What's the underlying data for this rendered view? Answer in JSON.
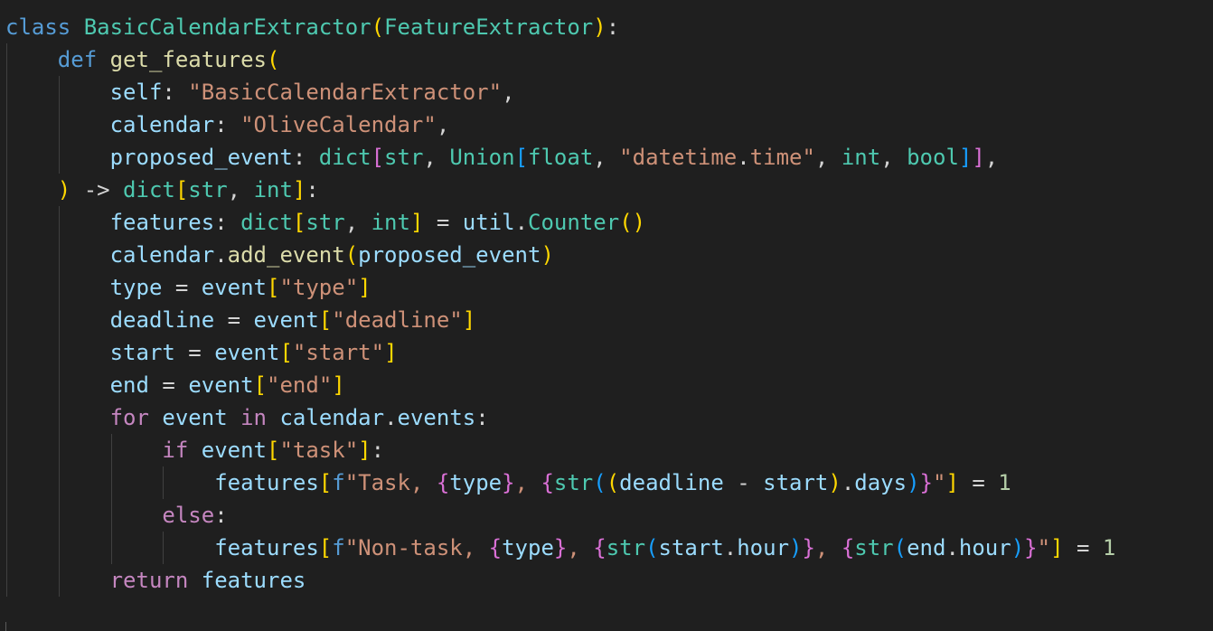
{
  "editor": {
    "language": "python",
    "theme_colors": {
      "background": "#1f1f1f",
      "keyword": "#569cd6",
      "control": "#c586c0",
      "class_name": "#4ec9b0",
      "function": "#dcdcaa",
      "variable": "#9cdcfe",
      "string": "#ce9178",
      "number": "#b5cea8",
      "punct": "#d4d4d4",
      "bracket1": "#ffd700",
      "bracket2": "#da70d6",
      "bracket3": "#179fff"
    },
    "lines": [
      [
        [
          "class",
          "kw"
        ],
        [
          " ",
          "p"
        ],
        [
          "BasicCalendarExtractor",
          "cls"
        ],
        [
          "(",
          "b1"
        ],
        [
          "FeatureExtractor",
          "cls"
        ],
        [
          ")",
          "b1"
        ],
        [
          ":",
          "p"
        ]
      ],
      [
        [
          "    ",
          "p"
        ],
        [
          "def",
          "kw"
        ],
        [
          " ",
          "p"
        ],
        [
          "get_features",
          "fn"
        ],
        [
          "(",
          "b1"
        ]
      ],
      [
        [
          "        ",
          "p"
        ],
        [
          "self",
          "var"
        ],
        [
          ": ",
          "p"
        ],
        [
          "\"BasicCalendarExtractor\"",
          "str"
        ],
        [
          ",",
          "p"
        ]
      ],
      [
        [
          "        ",
          "p"
        ],
        [
          "calendar",
          "var"
        ],
        [
          ": ",
          "p"
        ],
        [
          "\"OliveCalendar\"",
          "str"
        ],
        [
          ",",
          "p"
        ]
      ],
      [
        [
          "        ",
          "p"
        ],
        [
          "proposed_event",
          "var"
        ],
        [
          ": ",
          "p"
        ],
        [
          "dict",
          "cls"
        ],
        [
          "[",
          "b2"
        ],
        [
          "str",
          "cls"
        ],
        [
          ", ",
          "p"
        ],
        [
          "Union",
          "cls"
        ],
        [
          "[",
          "b3"
        ],
        [
          "float",
          "cls"
        ],
        [
          ", ",
          "p"
        ],
        [
          "\"datetime",
          "str"
        ],
        [
          ".",
          "p"
        ],
        [
          "time\"",
          "str"
        ],
        [
          ", ",
          "p"
        ],
        [
          "int",
          "cls"
        ],
        [
          ", ",
          "p"
        ],
        [
          "bool",
          "cls"
        ],
        [
          "]",
          "b3"
        ],
        [
          "]",
          "b2"
        ],
        [
          ",",
          "p"
        ]
      ],
      [
        [
          "    ",
          "p"
        ],
        [
          ")",
          "b1"
        ],
        [
          " -> ",
          "p"
        ],
        [
          "dict",
          "cls"
        ],
        [
          "[",
          "b1"
        ],
        [
          "str",
          "cls"
        ],
        [
          ", ",
          "p"
        ],
        [
          "int",
          "cls"
        ],
        [
          "]",
          "b1"
        ],
        [
          ":",
          "p"
        ]
      ],
      [
        [
          "        ",
          "p"
        ],
        [
          "features",
          "var"
        ],
        [
          ": ",
          "p"
        ],
        [
          "dict",
          "cls"
        ],
        [
          "[",
          "b1"
        ],
        [
          "str",
          "cls"
        ],
        [
          ", ",
          "p"
        ],
        [
          "int",
          "cls"
        ],
        [
          "]",
          "b1"
        ],
        [
          " = ",
          "p"
        ],
        [
          "util",
          "var"
        ],
        [
          ".",
          "p"
        ],
        [
          "Counter",
          "cls"
        ],
        [
          "()",
          "b1"
        ]
      ],
      [
        [
          "        ",
          "p"
        ],
        [
          "calendar",
          "var"
        ],
        [
          ".",
          "p"
        ],
        [
          "add_event",
          "fn"
        ],
        [
          "(",
          "b1"
        ],
        [
          "proposed_event",
          "var"
        ],
        [
          ")",
          "b1"
        ]
      ],
      [
        [
          "        ",
          "p"
        ],
        [
          "type",
          "var"
        ],
        [
          " = ",
          "p"
        ],
        [
          "event",
          "var"
        ],
        [
          "[",
          "b1"
        ],
        [
          "\"type\"",
          "str"
        ],
        [
          "]",
          "b1"
        ]
      ],
      [
        [
          "        ",
          "p"
        ],
        [
          "deadline",
          "var"
        ],
        [
          " = ",
          "p"
        ],
        [
          "event",
          "var"
        ],
        [
          "[",
          "b1"
        ],
        [
          "\"deadline\"",
          "str"
        ],
        [
          "]",
          "b1"
        ]
      ],
      [
        [
          "        ",
          "p"
        ],
        [
          "start",
          "var"
        ],
        [
          " = ",
          "p"
        ],
        [
          "event",
          "var"
        ],
        [
          "[",
          "b1"
        ],
        [
          "\"start\"",
          "str"
        ],
        [
          "]",
          "b1"
        ]
      ],
      [
        [
          "        ",
          "p"
        ],
        [
          "end",
          "var"
        ],
        [
          " = ",
          "p"
        ],
        [
          "event",
          "var"
        ],
        [
          "[",
          "b1"
        ],
        [
          "\"end\"",
          "str"
        ],
        [
          "]",
          "b1"
        ]
      ],
      [
        [
          "        ",
          "p"
        ],
        [
          "for",
          "ctl"
        ],
        [
          " ",
          "p"
        ],
        [
          "event",
          "var"
        ],
        [
          " ",
          "p"
        ],
        [
          "in",
          "ctl"
        ],
        [
          " ",
          "p"
        ],
        [
          "calendar",
          "var"
        ],
        [
          ".",
          "p"
        ],
        [
          "events",
          "var"
        ],
        [
          ":",
          "p"
        ]
      ],
      [
        [
          "            ",
          "p"
        ],
        [
          "if",
          "ctl"
        ],
        [
          " ",
          "p"
        ],
        [
          "event",
          "var"
        ],
        [
          "[",
          "b1"
        ],
        [
          "\"task\"",
          "str"
        ],
        [
          "]",
          "b1"
        ],
        [
          ":",
          "p"
        ]
      ],
      [
        [
          "                ",
          "p"
        ],
        [
          "features",
          "var"
        ],
        [
          "[",
          "b1"
        ],
        [
          "f",
          "kw"
        ],
        [
          "\"Task, ",
          "str"
        ],
        [
          "{",
          "b2"
        ],
        [
          "type",
          "var"
        ],
        [
          "}",
          "b2"
        ],
        [
          ", ",
          "str"
        ],
        [
          "{",
          "b2"
        ],
        [
          "str",
          "cls"
        ],
        [
          "(",
          "b3"
        ],
        [
          "(",
          "b1"
        ],
        [
          "deadline",
          "var"
        ],
        [
          " - ",
          "p"
        ],
        [
          "start",
          "var"
        ],
        [
          ")",
          "b1"
        ],
        [
          ".",
          "p"
        ],
        [
          "days",
          "var"
        ],
        [
          ")",
          "b3"
        ],
        [
          "}",
          "b2"
        ],
        [
          "\"",
          "str"
        ],
        [
          "]",
          "b1"
        ],
        [
          " = ",
          "p"
        ],
        [
          "1",
          "num"
        ]
      ],
      [
        [
          "            ",
          "p"
        ],
        [
          "else",
          "ctl"
        ],
        [
          ":",
          "p"
        ]
      ],
      [
        [
          "                ",
          "p"
        ],
        [
          "features",
          "var"
        ],
        [
          "[",
          "b1"
        ],
        [
          "f",
          "kw"
        ],
        [
          "\"Non-task, ",
          "str"
        ],
        [
          "{",
          "b2"
        ],
        [
          "type",
          "var"
        ],
        [
          "}",
          "b2"
        ],
        [
          ", ",
          "str"
        ],
        [
          "{",
          "b2"
        ],
        [
          "str",
          "cls"
        ],
        [
          "(",
          "b3"
        ],
        [
          "start",
          "var"
        ],
        [
          ".",
          "p"
        ],
        [
          "hour",
          "var"
        ],
        [
          ")",
          "b3"
        ],
        [
          "}",
          "b2"
        ],
        [
          ", ",
          "str"
        ],
        [
          "{",
          "b2"
        ],
        [
          "str",
          "cls"
        ],
        [
          "(",
          "b3"
        ],
        [
          "end",
          "var"
        ],
        [
          ".",
          "p"
        ],
        [
          "hour",
          "var"
        ],
        [
          ")",
          "b3"
        ],
        [
          "}",
          "b2"
        ],
        [
          "\"",
          "str"
        ],
        [
          "]",
          "b1"
        ],
        [
          " = ",
          "p"
        ],
        [
          "1",
          "num"
        ]
      ],
      [
        [
          "        ",
          "p"
        ],
        [
          "return",
          "ctl"
        ],
        [
          " ",
          "p"
        ],
        [
          "features",
          "var"
        ]
      ]
    ]
  }
}
